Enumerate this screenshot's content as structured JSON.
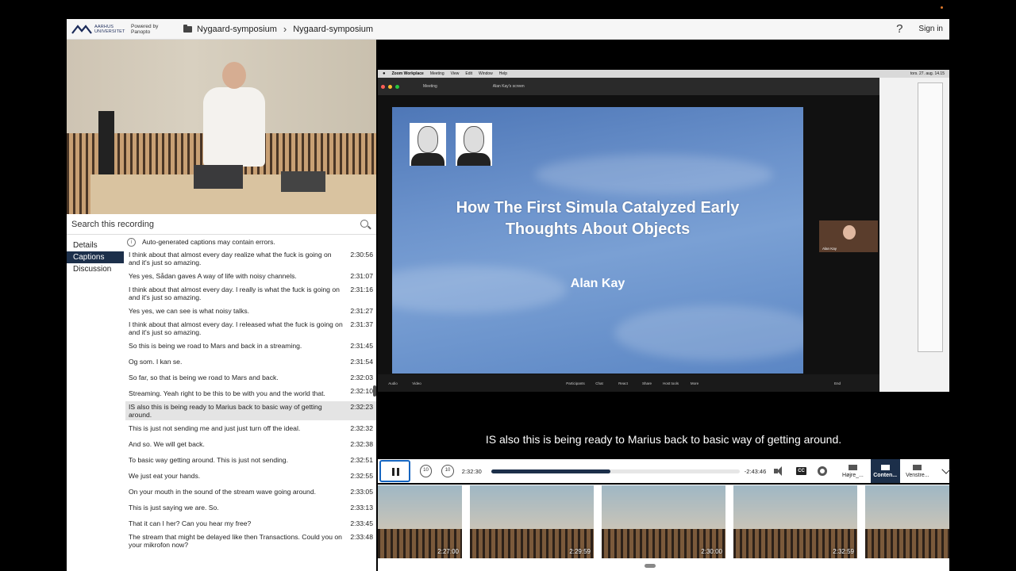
{
  "header": {
    "logo_text": "AARHUS UNIVERSITET",
    "powered_by": "Powered by Panopto",
    "breadcrumbs": [
      "Nygaard-symposium",
      "Nygaard-symposium"
    ],
    "help": "?",
    "signin": "Sign in"
  },
  "search": {
    "placeholder": "Search this recording"
  },
  "tabs": [
    {
      "label": "Details"
    },
    {
      "label": "Captions"
    },
    {
      "label": "Discussion"
    }
  ],
  "notice": "Auto-generated captions may contain errors.",
  "captions": [
    {
      "text": "I think about that almost every day realize what the fuck is going on and it's just so amazing.",
      "time": "2:30:56"
    },
    {
      "text": "Yes yes, Sådan gaves A way of life with noisy channels.",
      "time": "2:31:07"
    },
    {
      "text": "I think about that almost every day. I really is what the fuck is going on and it's just so amazing.",
      "time": "2:31:16"
    },
    {
      "text": "Yes yes, we can see is what noisy talks.",
      "time": "2:31:27"
    },
    {
      "text": "I think about that almost every day. I released what the fuck is going on and it's just so amazing.",
      "time": "2:31:37"
    },
    {
      "text": "So this is being we road to Mars and back in a streaming.",
      "time": "2:31:45"
    },
    {
      "text": "Og som. I kan se.",
      "time": "2:31:54"
    },
    {
      "text": "So far, so that is being we road to Mars and back.",
      "time": "2:32:03"
    },
    {
      "text": "Streaming. Yeah right to be this to be with you and the world that.",
      "time": "2:32:10"
    },
    {
      "text": "IS also this is being ready to Marius back to basic way of getting around.",
      "time": "2:32:23"
    },
    {
      "text": "This is just not sending me and just just turn off the ideal.",
      "time": "2:32:32"
    },
    {
      "text": "And so. We will get back.",
      "time": "2:32:38"
    },
    {
      "text": "To basic way getting around. This is just not sending.",
      "time": "2:32:51"
    },
    {
      "text": "We just eat your hands.",
      "time": "2:32:55"
    },
    {
      "text": "On your mouth in the sound of the stream wave going around.",
      "time": "2:33:05"
    },
    {
      "text": "This is just saying we are. So.",
      "time": "2:33:13"
    },
    {
      "text": "That it can I her? Can you hear my free?",
      "time": "2:33:45"
    },
    {
      "text": "The stream that might be delayed like then Transactions. Could you on your mikrofon now?",
      "time": "2:33:48"
    }
  ],
  "screen": {
    "mac_menu": [
      "Zoom Workplace",
      "Meeting",
      "View",
      "Edit",
      "Window",
      "Help"
    ],
    "mac_clock": "tors. 27. aug. 14.15",
    "zoom_meeting": "Meeting",
    "zoom_shared": "Alan Kay's screen",
    "slide_title_1": "How The First Simula Catalyzed Early",
    "slide_title_2": "Thoughts About Objects",
    "slide_author": "Alan Kay",
    "participant_name": "Alan Kay",
    "zoom_controls": [
      "Audio",
      "Video",
      "Participants",
      "Chat",
      "React",
      "Share",
      "Host tools",
      "More",
      "End"
    ]
  },
  "subtitle": "IS also this is being ready to Marius back to basic way of getting around.",
  "player": {
    "skip_back": "10",
    "skip_fwd": "10",
    "current_time": "2:32:30",
    "remaining_time": "-2:43:46",
    "progress_fraction": 0.48,
    "cc": "CC",
    "streams": [
      {
        "label": "Højre_..."
      },
      {
        "label": "Conten..."
      },
      {
        "label": "Venstre..."
      }
    ]
  },
  "thumbnails": [
    {
      "time": "2:27:00"
    },
    {
      "time": "2:29:59"
    },
    {
      "time": "2:30:00"
    },
    {
      "time": "2:32:59"
    },
    {
      "time": ""
    }
  ],
  "colors": {
    "accent_navy": "#1c2f4a",
    "focus_blue": "#1565c0",
    "slide_blue": "#6c93cc"
  }
}
